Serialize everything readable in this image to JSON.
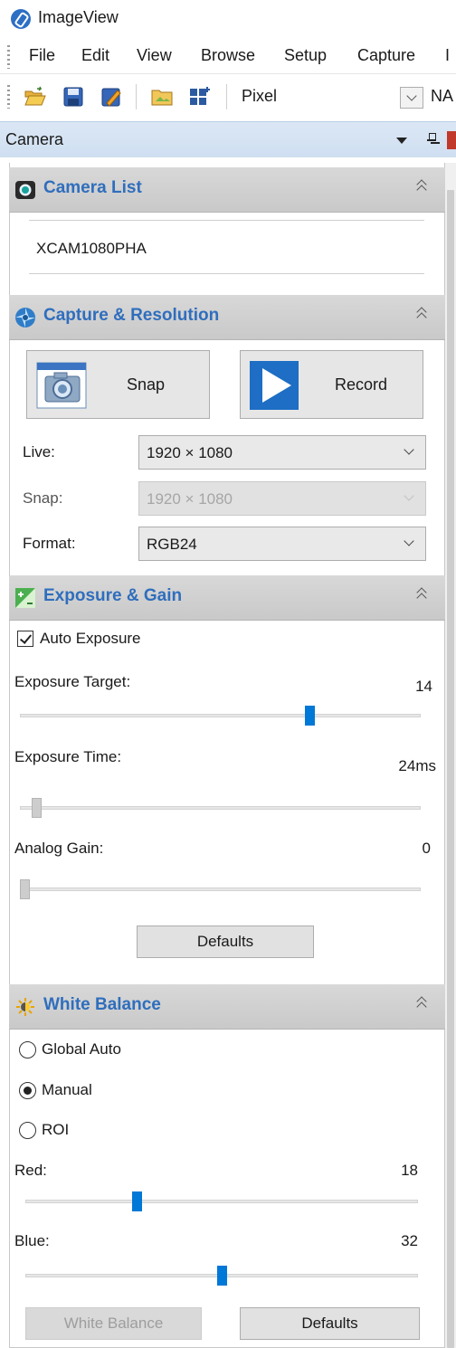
{
  "window": {
    "title": "ImageView"
  },
  "menu": [
    "File",
    "Edit",
    "View",
    "Browse",
    "Setup",
    "Capture",
    "I"
  ],
  "toolbar": {
    "unit": "Pixel",
    "na_text": "NA"
  },
  "dock": {
    "title": "Camera"
  },
  "camera_list": {
    "title": "Camera List",
    "device": "XCAM1080PHA"
  },
  "capture": {
    "title": "Capture & Resolution",
    "snap_label": "Snap",
    "record_label": "Record",
    "live_label": "Live:",
    "live_value": "1920 × 1080",
    "snap_res_label": "Snap:",
    "snap_res_value": "1920 × 1080",
    "format_label": "Format:",
    "format_value": "RGB24"
  },
  "exposure": {
    "title": "Exposure & Gain",
    "auto_label": "Auto Exposure",
    "auto_checked": true,
    "target_label": "Exposure Target:",
    "target_value": "14",
    "target_pos": 0.73,
    "time_label": "Exposure Time:",
    "time_value": "24ms",
    "time_pos": 0.03,
    "gain_label": "Analog Gain:",
    "gain_value": "0",
    "gain_pos": 0.0,
    "defaults_label": "Defaults"
  },
  "white_balance": {
    "title": "White Balance",
    "global_auto_label": "Global Auto",
    "manual_label": "Manual",
    "roi_label": "ROI",
    "selected": "Manual",
    "red_label": "Red:",
    "red_value": "18",
    "red_pos": 0.28,
    "blue_label": "Blue:",
    "blue_value": "32",
    "blue_pos": 0.5,
    "wb_button_label": "White Balance",
    "defaults_label": "Defaults"
  }
}
